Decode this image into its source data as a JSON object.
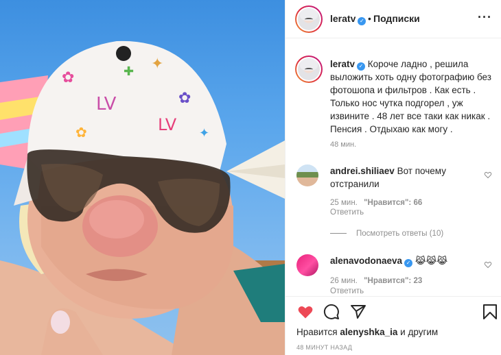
{
  "header": {
    "username": "leratv",
    "separator": "•",
    "follow_label": "Подписки",
    "more_label": "···"
  },
  "caption": {
    "username": "leratv",
    "text": "Короче ладно , решила выложить хоть одну фотографию без фотошопа и фильтров . Как есть . Только нос чутка подгорел , уж извините . 48 лет все таки как никак . Пенсия . Отдыхаю как могу .",
    "time": "48 мин."
  },
  "comments": [
    {
      "username": "andrei.shiliaev",
      "text": "Вот почему отстранили",
      "time": "25 мин.",
      "likes": "\"Нравится\": 66",
      "reply_label": "Ответить"
    },
    {
      "username": "alenavodonaeva",
      "emoji": "😹😹😹",
      "time": "26 мин.",
      "likes": "\"Нравится\": 23",
      "reply_label": "Ответить"
    }
  ],
  "view_replies_label": "Посмотреть ответы (10)",
  "footer": {
    "liked_by_prefix": "Нравится",
    "liked_by_user": "alenyshka_ia",
    "liked_by_suffix": "и другим",
    "posted_ago": "48 МИНУТ НАЗАД"
  },
  "colors": {
    "liked_heart": "#ed4956",
    "verified": "#3897f0",
    "muted_text": "#8e8e8e"
  },
  "icons": [
    "heart-icon",
    "comment-icon",
    "share-icon",
    "bookmark-icon",
    "more-icon",
    "verified-icon"
  ]
}
